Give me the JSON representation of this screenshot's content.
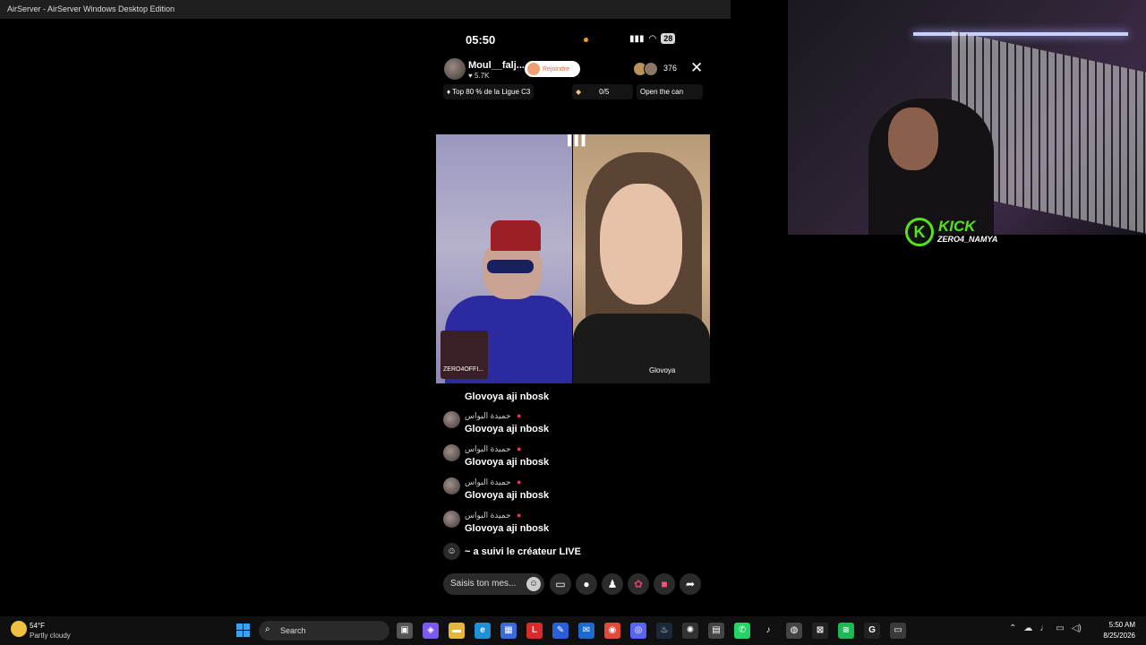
{
  "window": {
    "title": "AirServer - AirServer Windows Desktop Edition"
  },
  "phone_status": {
    "time": "05:50",
    "battery": "28",
    "signal_icon": "signal-icon",
    "wifi_icon": "wifi-icon"
  },
  "live_header": {
    "host_name": "Moul__falj...",
    "host_likes": "5.7K",
    "join_label": "Rejoindre",
    "viewer_count": "376",
    "league": "Top 80 % de la Ligue C3",
    "goal_progress": "0/5",
    "can_label": "Open the can"
  },
  "video": {
    "left_thumb_label": "ZERO4OFFI...",
    "right_name": "Glovoya"
  },
  "chat": {
    "top_partial": "Glovoya aji nbosk",
    "messages": [
      {
        "user": "حميدة البواس",
        "text": "Glovoya aji nbosk"
      },
      {
        "user": "حميدة البواس",
        "text": "Glovoya aji nbosk"
      },
      {
        "user": "حميدة البواس",
        "text": "Glovoya aji nbosk"
      },
      {
        "user": "حميدة البواس",
        "text": "Glovoya aji nbosk"
      }
    ],
    "follow_notice": "~ a suivi le créateur LIVE"
  },
  "bottom_bar": {
    "input_placeholder": "Saisis ton mes..."
  },
  "overlay": {
    "brand": "KICK",
    "username": "ZERO4_NAMYA"
  },
  "taskbar": {
    "weather_temp": "54°F",
    "weather_desc": "Partly cloudy",
    "search_label": "Search",
    "time": "5:50 AM",
    "date": "8/25/2026"
  },
  "colors": {
    "kick_green": "#56e21c",
    "join_orange": "#e06a3a"
  }
}
